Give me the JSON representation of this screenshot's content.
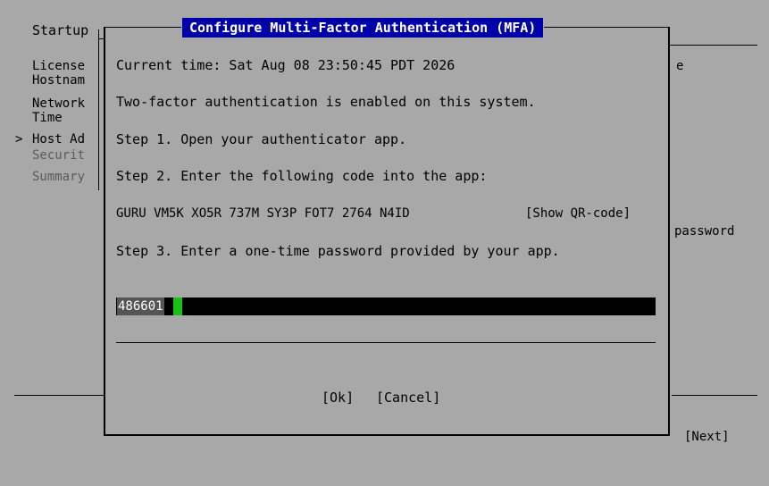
{
  "background": {
    "section_label": "Startup",
    "sidebar": [
      {
        "label": "License",
        "state": "normal"
      },
      {
        "label": "Hostnam",
        "state": "normal"
      },
      {
        "label": "Network",
        "state": "normal"
      },
      {
        "label": "Time",
        "state": "normal"
      },
      {
        "label": "Host Ad",
        "state": "current",
        "marker": ">"
      },
      {
        "label": "Securit",
        "state": "disabled"
      },
      {
        "label": "Summary",
        "state": "disabled"
      }
    ],
    "right_text_1": "e",
    "right_text_2": "password",
    "next_button": "[Next]"
  },
  "dialog": {
    "title": "Configure Multi-Factor Authentication (MFA)",
    "current_time": "Current time: Sat Aug 08 23:50:45 PDT 2026",
    "enabled_msg": "Two-factor authentication is enabled on this system.",
    "step1": "Step 1. Open your authenticator app.",
    "step2": "Step 2. Enter the following code into the app:",
    "secret_code": "GURU VM5K XO5R 737M SY3P FOT7 2764 N4ID",
    "show_qr_button": "[Show QR-code]",
    "step3": "Step 3. Enter a one-time password provided by your app.",
    "otp_value": "486601",
    "ok_button": "[Ok]",
    "cancel_button": "[Cancel]"
  }
}
